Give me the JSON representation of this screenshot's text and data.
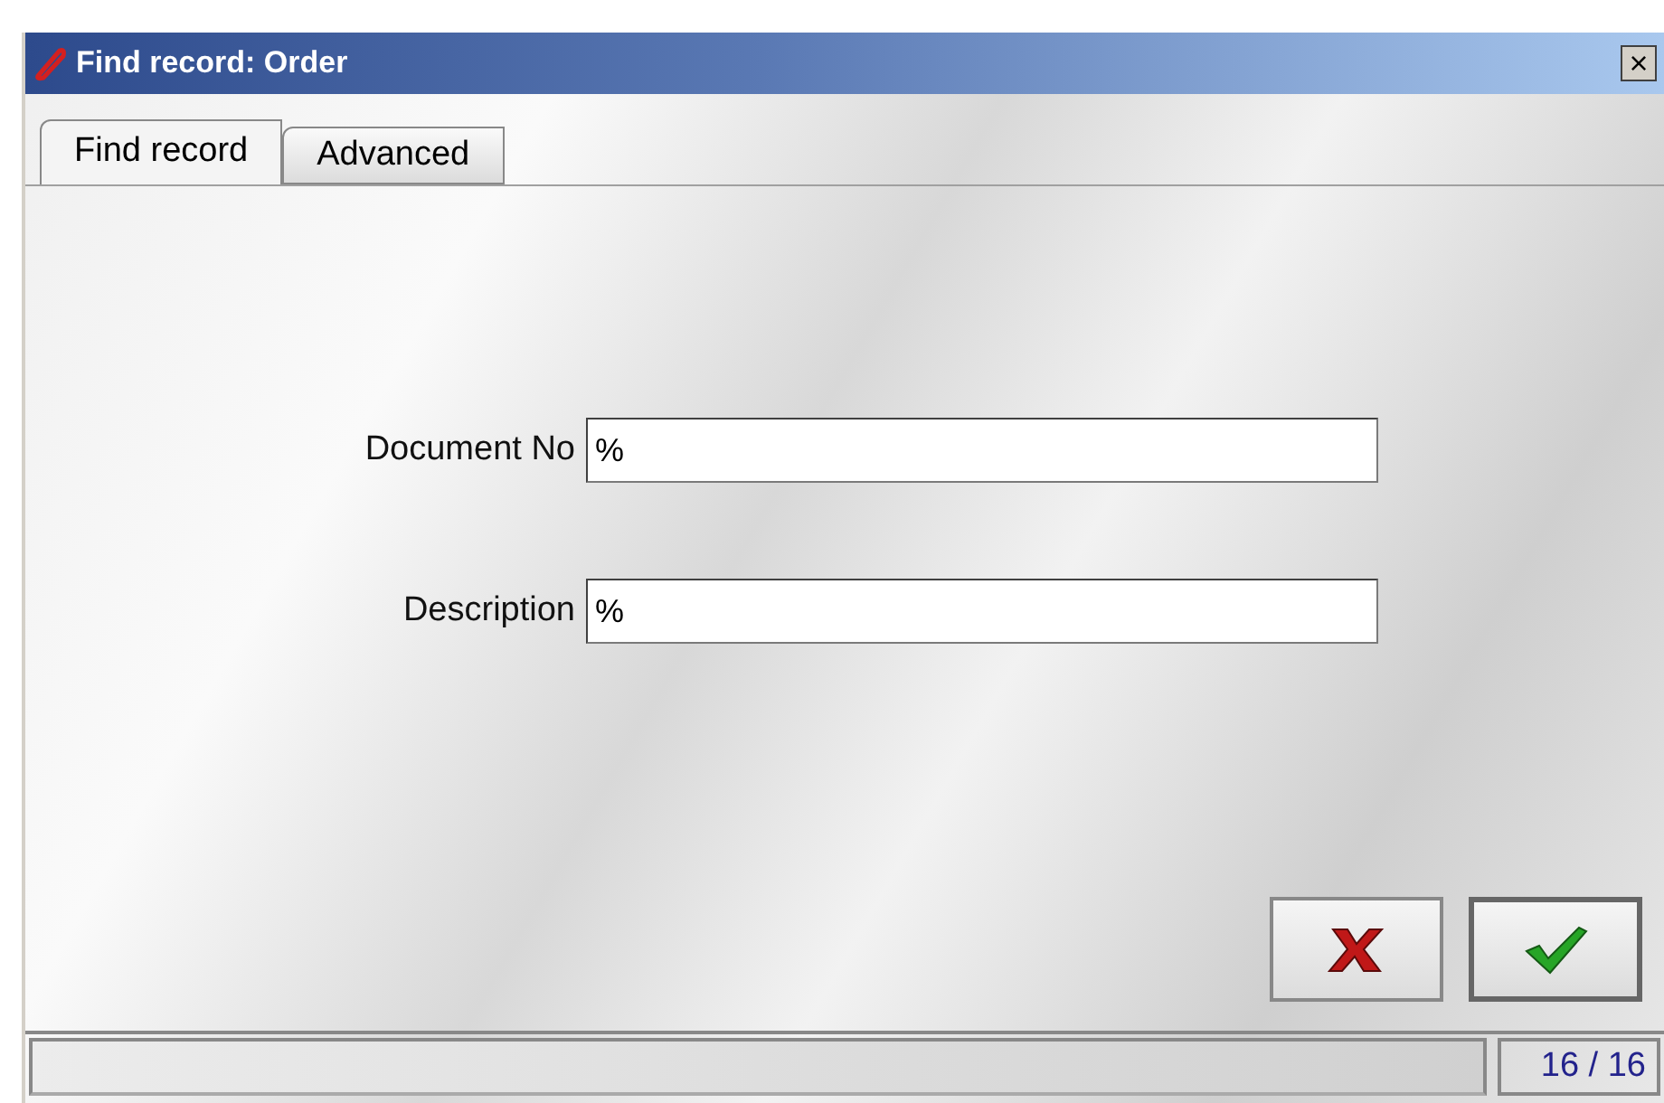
{
  "window": {
    "title": "Find record: Order",
    "close": "×"
  },
  "tabs": [
    {
      "label": "Find record",
      "selected": true
    },
    {
      "label": "Advanced",
      "selected": false
    }
  ],
  "fields": [
    {
      "label": "Document No",
      "value": "%"
    },
    {
      "label": "Description",
      "value": "%"
    }
  ],
  "status_bar": {
    "counter": "16 / 16"
  }
}
